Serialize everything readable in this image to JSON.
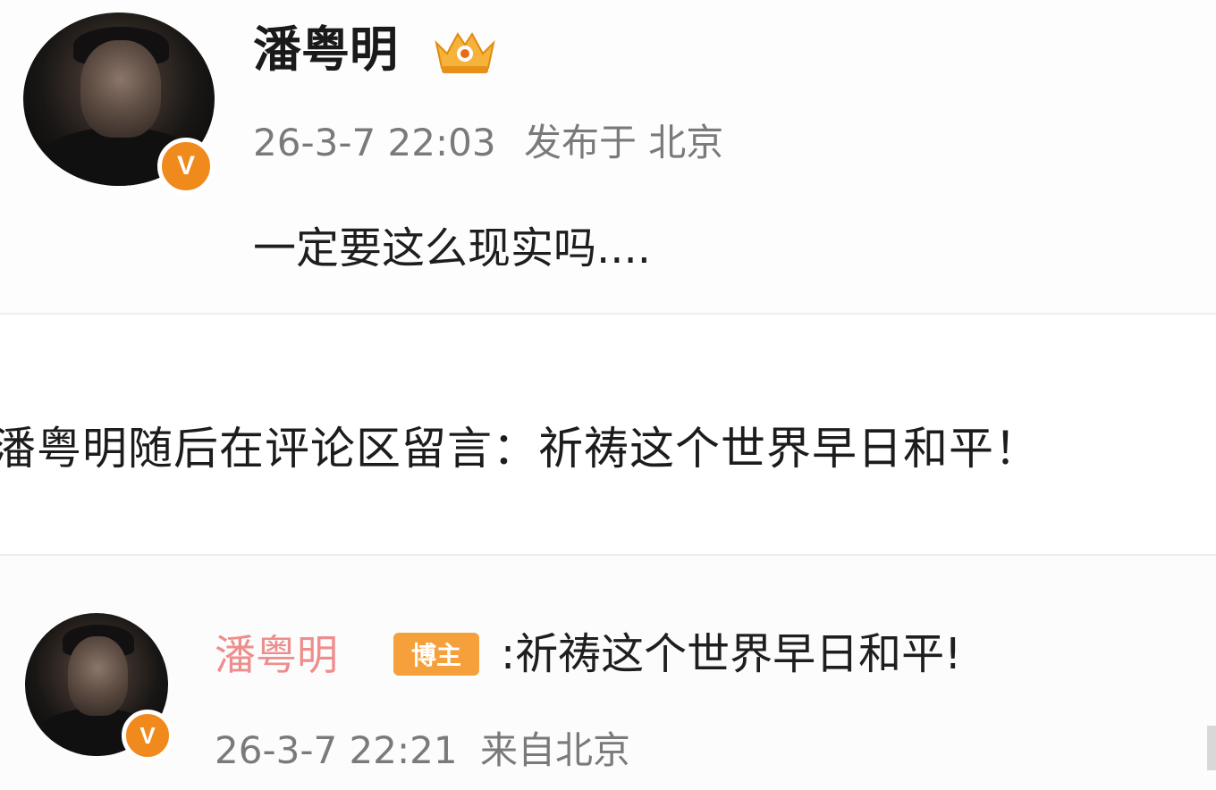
{
  "post": {
    "username": "潘粤明",
    "crown_icon": "crown-badge-icon",
    "verified_mark": "V",
    "timestamp": "26-3-7 22:03",
    "location_label": "发布于 北京",
    "content": "一定要这么现实吗...."
  },
  "caption": {
    "text": "潘粤明随后在评论区留言：祈祷这个世界早日和平！"
  },
  "comment": {
    "username": "潘粤明",
    "owner_badge": "博主",
    "text": ":祈祷这个世界早日和平!",
    "verified_mark": "V",
    "timestamp": "26-3-7 22:21",
    "location_label": "来自北京"
  },
  "colors": {
    "verified": "#f08a1c",
    "owner_badge": "#f5a03a",
    "comment_username": "#ee8e8c",
    "meta_text": "#7a7a7a"
  }
}
